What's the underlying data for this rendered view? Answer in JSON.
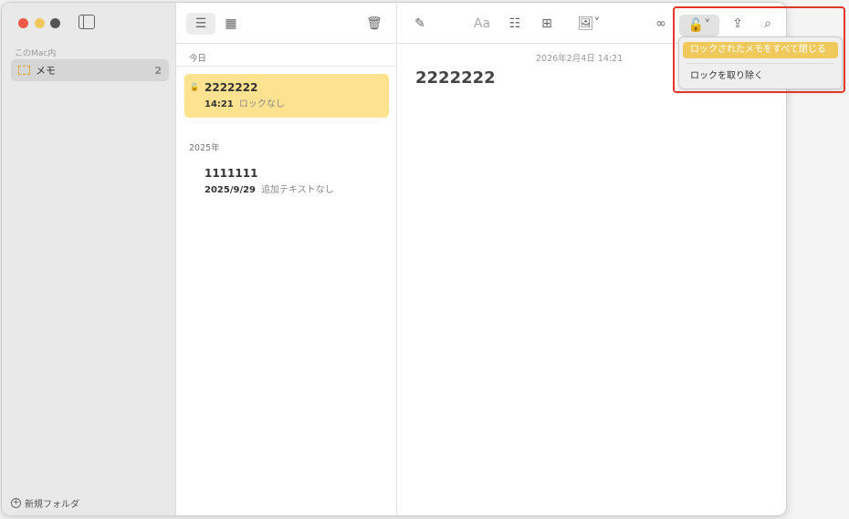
{
  "sidebar": {
    "section": "このMac内",
    "folders": [
      {
        "label": "メモ",
        "count": "2"
      }
    ],
    "new_folder": "新規フォルダ"
  },
  "list": {
    "groups": [
      {
        "header": "今日",
        "notes": [
          {
            "title": "2222222",
            "time": "14:21",
            "preview": "ロックなし",
            "locked": true,
            "selected": true
          }
        ]
      },
      {
        "header": "2025年",
        "notes": [
          {
            "title": "1111111",
            "time": "2025/9/29",
            "preview": "追加テキストなし"
          }
        ]
      }
    ]
  },
  "editor": {
    "meta": "2026年2月4日 14:21",
    "title": "2222222",
    "format_label": "Aa"
  },
  "lock_menu": {
    "items": [
      "ロックされたメモをすべて閉じる",
      "ロックを取り除く"
    ]
  },
  "colors": {
    "accent": "#f0c95c",
    "selected_note": "#fde38f",
    "highlight": "#e2372a"
  }
}
